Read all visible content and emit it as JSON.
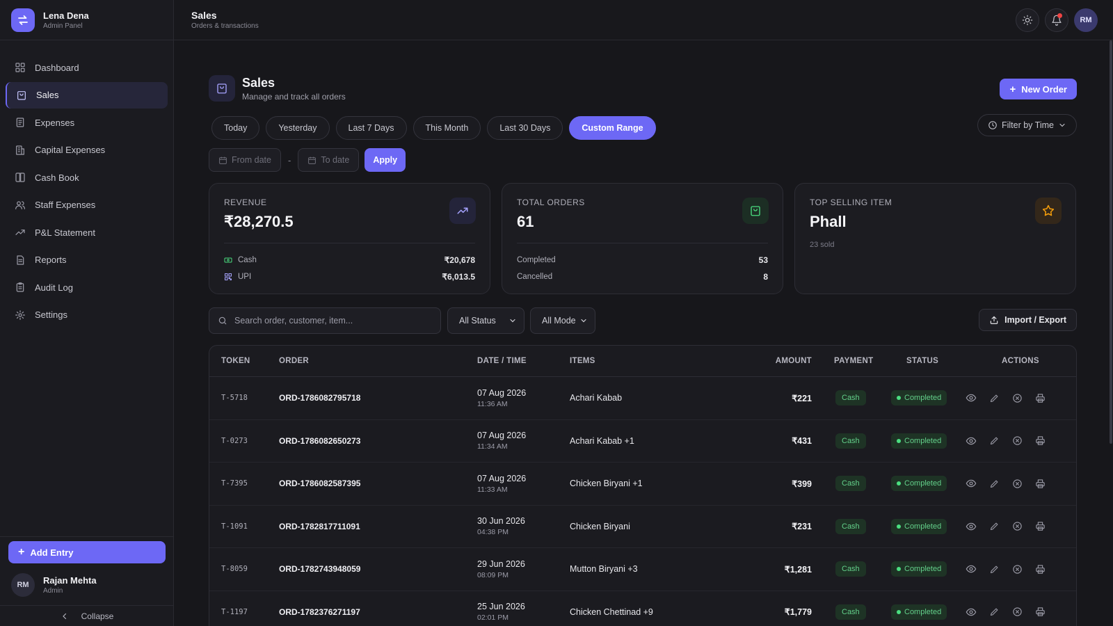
{
  "brand": {
    "name": "Lena Dena",
    "subtitle": "Admin Panel"
  },
  "sidebar": {
    "items": [
      {
        "label": "Dashboard",
        "icon": "grid-icon"
      },
      {
        "label": "Sales",
        "icon": "shopping-bag-icon",
        "active": true
      },
      {
        "label": "Expenses",
        "icon": "receipt-icon"
      },
      {
        "label": "Capital Expenses",
        "icon": "building-icon"
      },
      {
        "label": "Cash Book",
        "icon": "book-icon"
      },
      {
        "label": "Staff Expenses",
        "icon": "users-icon"
      },
      {
        "label": "P&L Statement",
        "icon": "trend-up-icon"
      },
      {
        "label": "Reports",
        "icon": "file-icon"
      },
      {
        "label": "Audit Log",
        "icon": "clipboard-icon"
      },
      {
        "label": "Settings",
        "icon": "gear-icon"
      }
    ],
    "add_entry": "Add Entry",
    "user": {
      "initials": "RM",
      "name": "Rajan Mehta",
      "role": "Admin"
    },
    "collapse": "Collapse"
  },
  "topbar": {
    "title": "Sales",
    "subtitle": "Orders & transactions",
    "avatar": "RM"
  },
  "page": {
    "title": "Sales",
    "subtitle": "Manage and track all orders",
    "new_order": "New Order"
  },
  "tabs": [
    "Today",
    "Yesterday",
    "Last 7 Days",
    "This Month",
    "Last 30 Days",
    "Custom Range"
  ],
  "active_tab": "Custom Range",
  "filter_time": "Filter by Time",
  "date_range": {
    "from_placeholder": "From date",
    "separator": "-",
    "to_placeholder": "To date",
    "apply": "Apply"
  },
  "cards": {
    "revenue": {
      "label": "Revenue",
      "value": "₹28,270.5",
      "rows": [
        {
          "label": "Cash",
          "value": "₹20,678"
        },
        {
          "label": "UPI",
          "value": "₹6,013.5"
        }
      ]
    },
    "orders": {
      "label": "Total Orders",
      "value": "61",
      "rows": [
        {
          "label": "Completed",
          "value": "53"
        },
        {
          "label": "Cancelled",
          "value": "8"
        }
      ]
    },
    "top_item": {
      "label": "Top Selling Item",
      "value": "Phall",
      "note": "23 sold"
    }
  },
  "toolbar": {
    "search_placeholder": "Search order, customer, item...",
    "status_select": "All Status",
    "mode_select": "All Mode",
    "import_export": "Import / Export"
  },
  "table": {
    "columns": [
      "TOKEN",
      "ORDER",
      "DATE / TIME",
      "ITEMS",
      "AMOUNT",
      "PAYMENT",
      "STATUS",
      "ACTIONS"
    ],
    "rows": [
      {
        "token": "T-5718",
        "order": "ORD-1786082795718",
        "date": "07 Aug 2026",
        "time": "11:36 AM",
        "items": "Achari Kabab",
        "amount": "₹221",
        "payment": "Cash",
        "status": "Completed"
      },
      {
        "token": "T-0273",
        "order": "ORD-1786082650273",
        "date": "07 Aug 2026",
        "time": "11:34 AM",
        "items": "Achari Kabab +1",
        "amount": "₹431",
        "payment": "Cash",
        "status": "Completed"
      },
      {
        "token": "T-7395",
        "order": "ORD-1786082587395",
        "date": "07 Aug 2026",
        "time": "11:33 AM",
        "items": "Chicken Biryani +1",
        "amount": "₹399",
        "payment": "Cash",
        "status": "Completed"
      },
      {
        "token": "T-1091",
        "order": "ORD-1782817711091",
        "date": "30 Jun 2026",
        "time": "04:38 PM",
        "items": "Chicken Biryani",
        "amount": "₹231",
        "payment": "Cash",
        "status": "Completed"
      },
      {
        "token": "T-8059",
        "order": "ORD-1782743948059",
        "date": "29 Jun 2026",
        "time": "08:09 PM",
        "items": "Mutton Biryani +3",
        "amount": "₹1,281",
        "payment": "Cash",
        "status": "Completed"
      },
      {
        "token": "T-1197",
        "order": "ORD-1782376271197",
        "date": "25 Jun 2026",
        "time": "02:01 PM",
        "items": "Chicken Chettinad +9",
        "amount": "₹1,779",
        "payment": "Cash",
        "status": "Completed"
      }
    ]
  },
  "colors": {
    "accent": "#6d68f5",
    "background": "#17171b",
    "success": "#4ade80",
    "notification": "#ef4444",
    "star": "#f59e0b"
  }
}
